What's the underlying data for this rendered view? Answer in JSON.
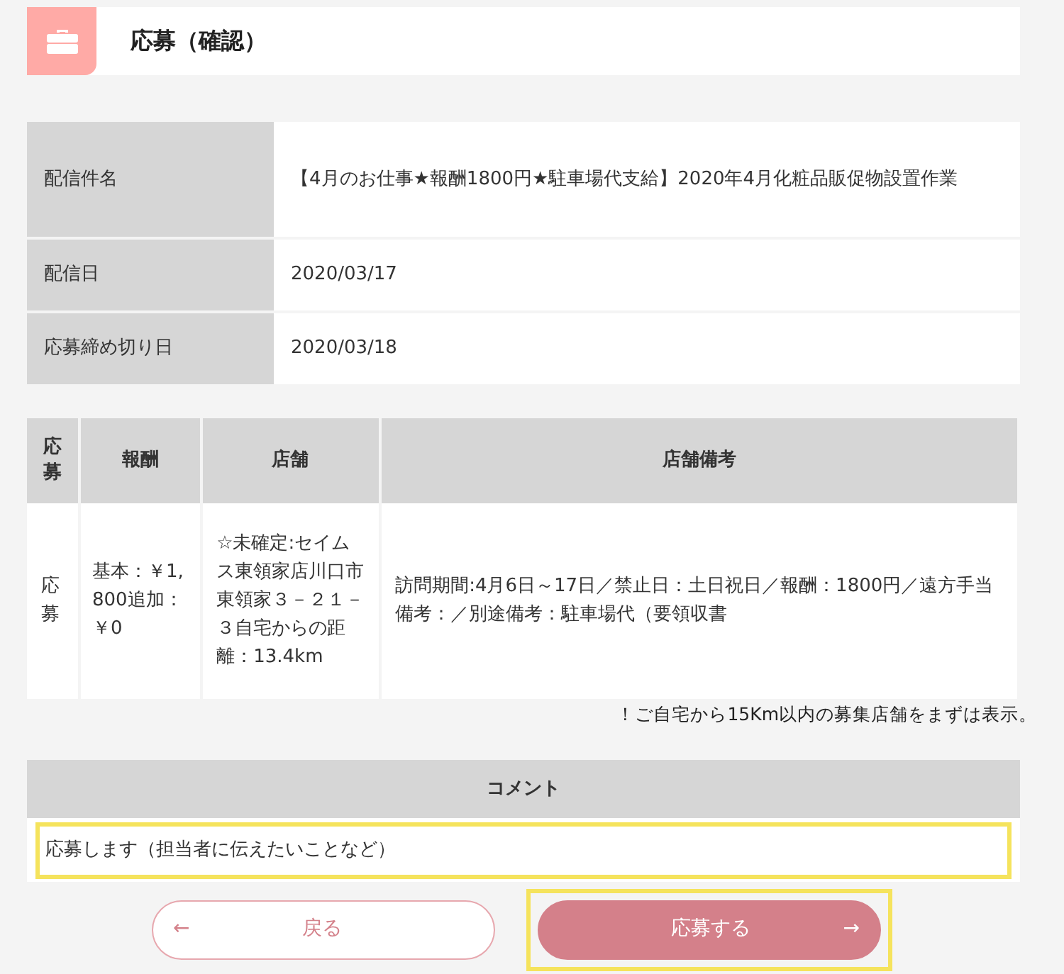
{
  "header": {
    "title": "応募（確認）"
  },
  "details": [
    {
      "label": "配信件名",
      "value": "【4月のお仕事★報酬1800円★駐車場代支給】2020年4月化粧品販促物設置作業"
    },
    {
      "label": "配信日",
      "value": "2020/03/17"
    },
    {
      "label": "応募締め切り日",
      "value": "2020/03/18"
    }
  ],
  "stores": {
    "columns": [
      "応募",
      "報酬",
      "店舗",
      "店舗備考"
    ],
    "rows": [
      {
        "cells": [
          "応募",
          "基本：￥1,800追加：￥0",
          "☆未確定:セイムス東領家店川口市東領家３－２１－３自宅からの距離：13.4km",
          "訪問期間:4月6日～17日／禁止日：土日祝日／報酬：1800円／遠方手当備考：／別途備考：駐車場代（要領収書"
        ]
      }
    ]
  },
  "note": "！ご自宅から15Km以内の募集店舗をまずは表示。",
  "comment": {
    "heading": "コメント",
    "placeholder": "応募します（担当者に伝えたいことなど）",
    "highlighted": true
  },
  "buttons": [
    {
      "kind": "back",
      "label": "戻る",
      "icon": "←",
      "highlighted": false
    },
    {
      "kind": "apply",
      "label": "応募する",
      "icon": "→",
      "highlighted": true
    }
  ]
}
